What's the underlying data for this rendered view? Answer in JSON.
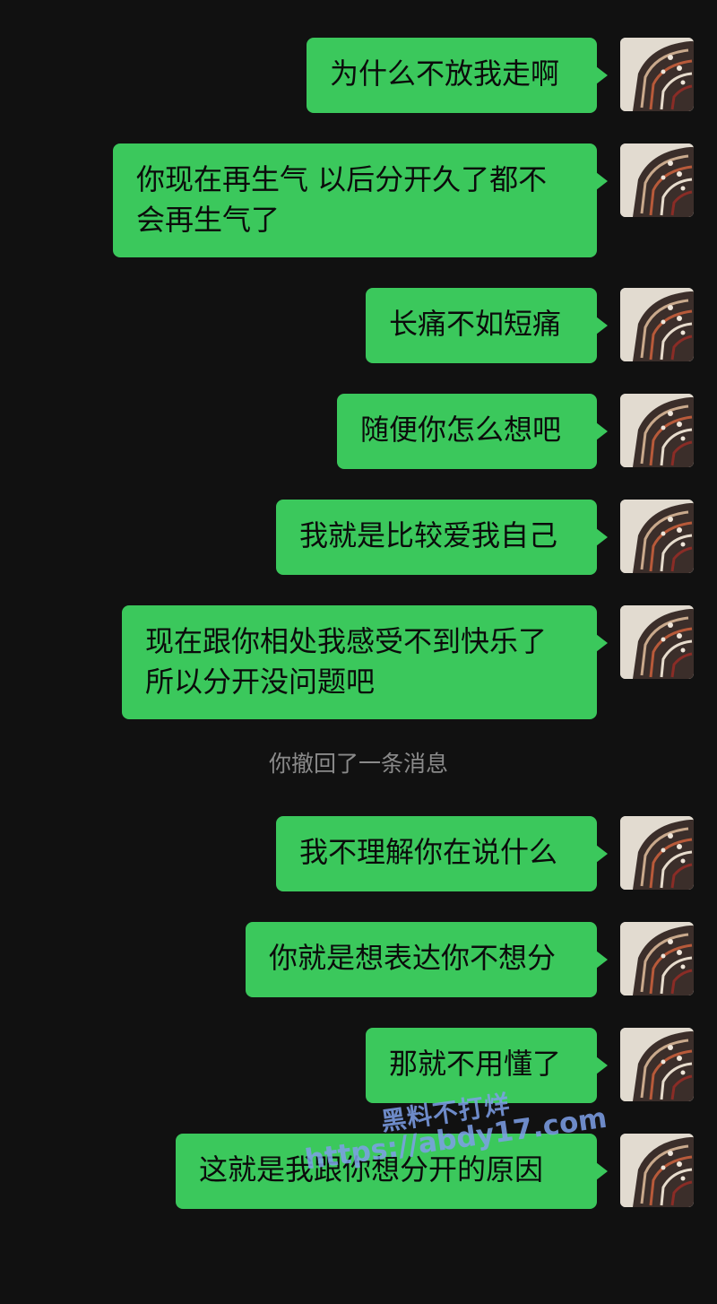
{
  "messages": [
    {
      "text": "为什么不放我走啊"
    },
    {
      "text": "你现在再生气 以后分开久了都不\n会再生气了"
    },
    {
      "text": "长痛不如短痛"
    },
    {
      "text": "随便你怎么想吧"
    },
    {
      "text": "我就是比较爱我自己"
    },
    {
      "text": "现在跟你相处我感受不到快乐了\n所以分开没问题吧"
    },
    {
      "text": "我不理解你在说什么"
    },
    {
      "text": "你就是想表达你不想分"
    },
    {
      "text": "那就不用懂了"
    },
    {
      "text": "这就是我跟你想分开的原因"
    }
  ],
  "system_notice": "你撤回了一条消息",
  "watermark": {
    "line1": "黑料不打烊",
    "line2": "https://abdy17.com"
  },
  "colors": {
    "background": "#111111",
    "bubble": "#3bc85c",
    "notice_text": "#8a8a8a",
    "watermark": "#7ea0e8"
  },
  "avatar_icon": "moth-wing-avatar-icon"
}
